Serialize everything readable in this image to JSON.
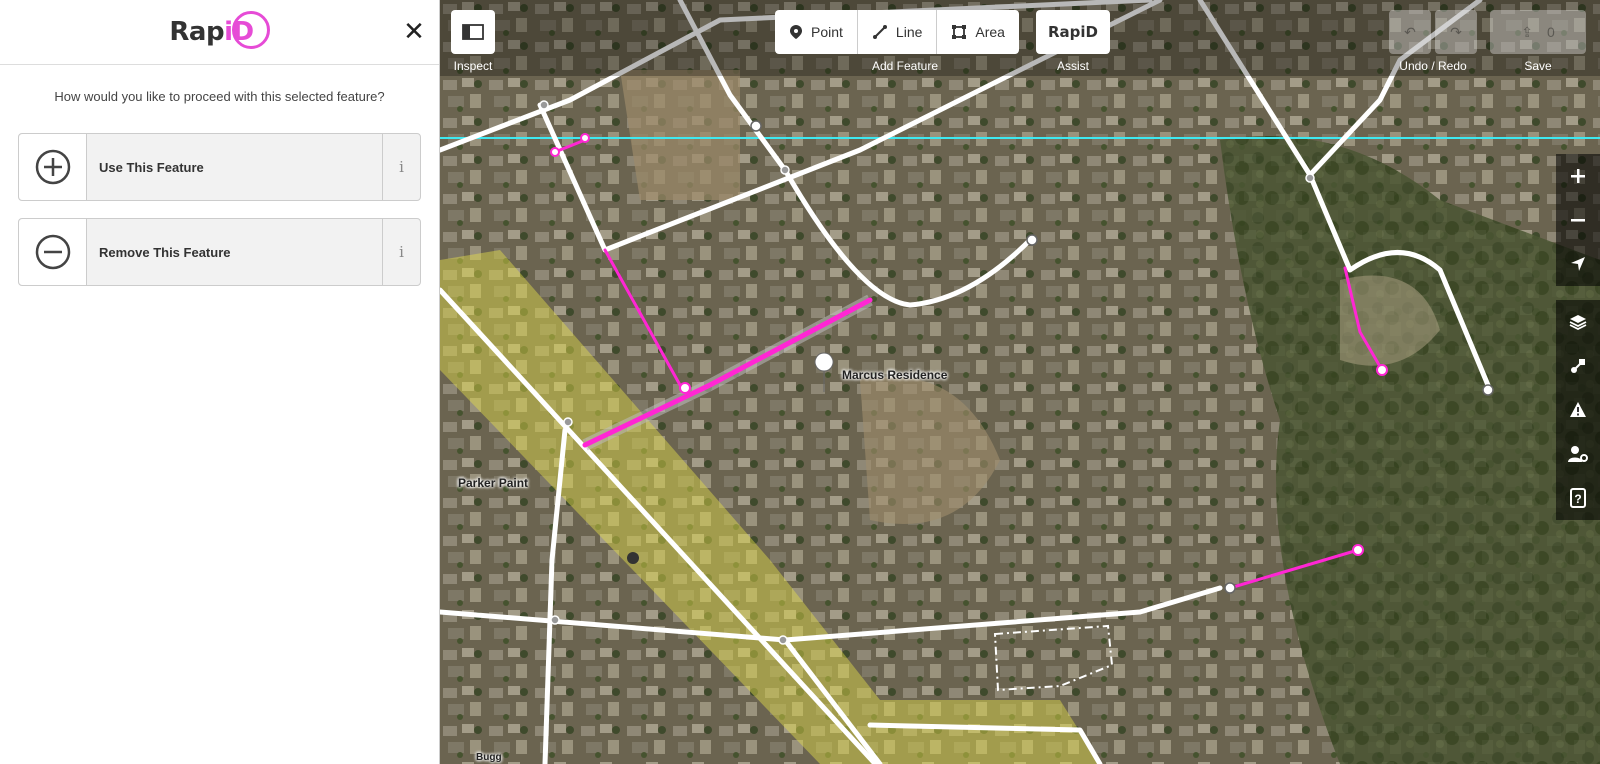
{
  "sidebar": {
    "logo_text": "Rap",
    "logo_accent": "iD",
    "close_icon": "close-icon",
    "prompt": "How would you like to proceed with this selected feature?",
    "choices": [
      {
        "label": "Use This Feature",
        "icon": "plus-circle-icon",
        "info": "i"
      },
      {
        "label": "Remove This Feature",
        "icon": "minus-circle-icon",
        "info": "i"
      }
    ]
  },
  "toolbar": {
    "inspect_label": "Inspect",
    "add_feature_label": "Add Feature",
    "point_label": "Point",
    "line_label": "Line",
    "area_label": "Area",
    "assist_button_text": "RapiD",
    "assist_label": "Assist",
    "undo_redo_label": "Undo / Redo",
    "save_label": "Save",
    "save_count": "0"
  },
  "map": {
    "labels": {
      "marcus": "Marcus Residence",
      "parker": "Parker Paint",
      "bottom_cut": "Bugg"
    }
  },
  "colors": {
    "accent": "#e64bd6",
    "road": "#ffffff",
    "selected": "#ff26d4",
    "highlight": "#e6e04a",
    "cyan_guide": "#3ee8f0"
  }
}
